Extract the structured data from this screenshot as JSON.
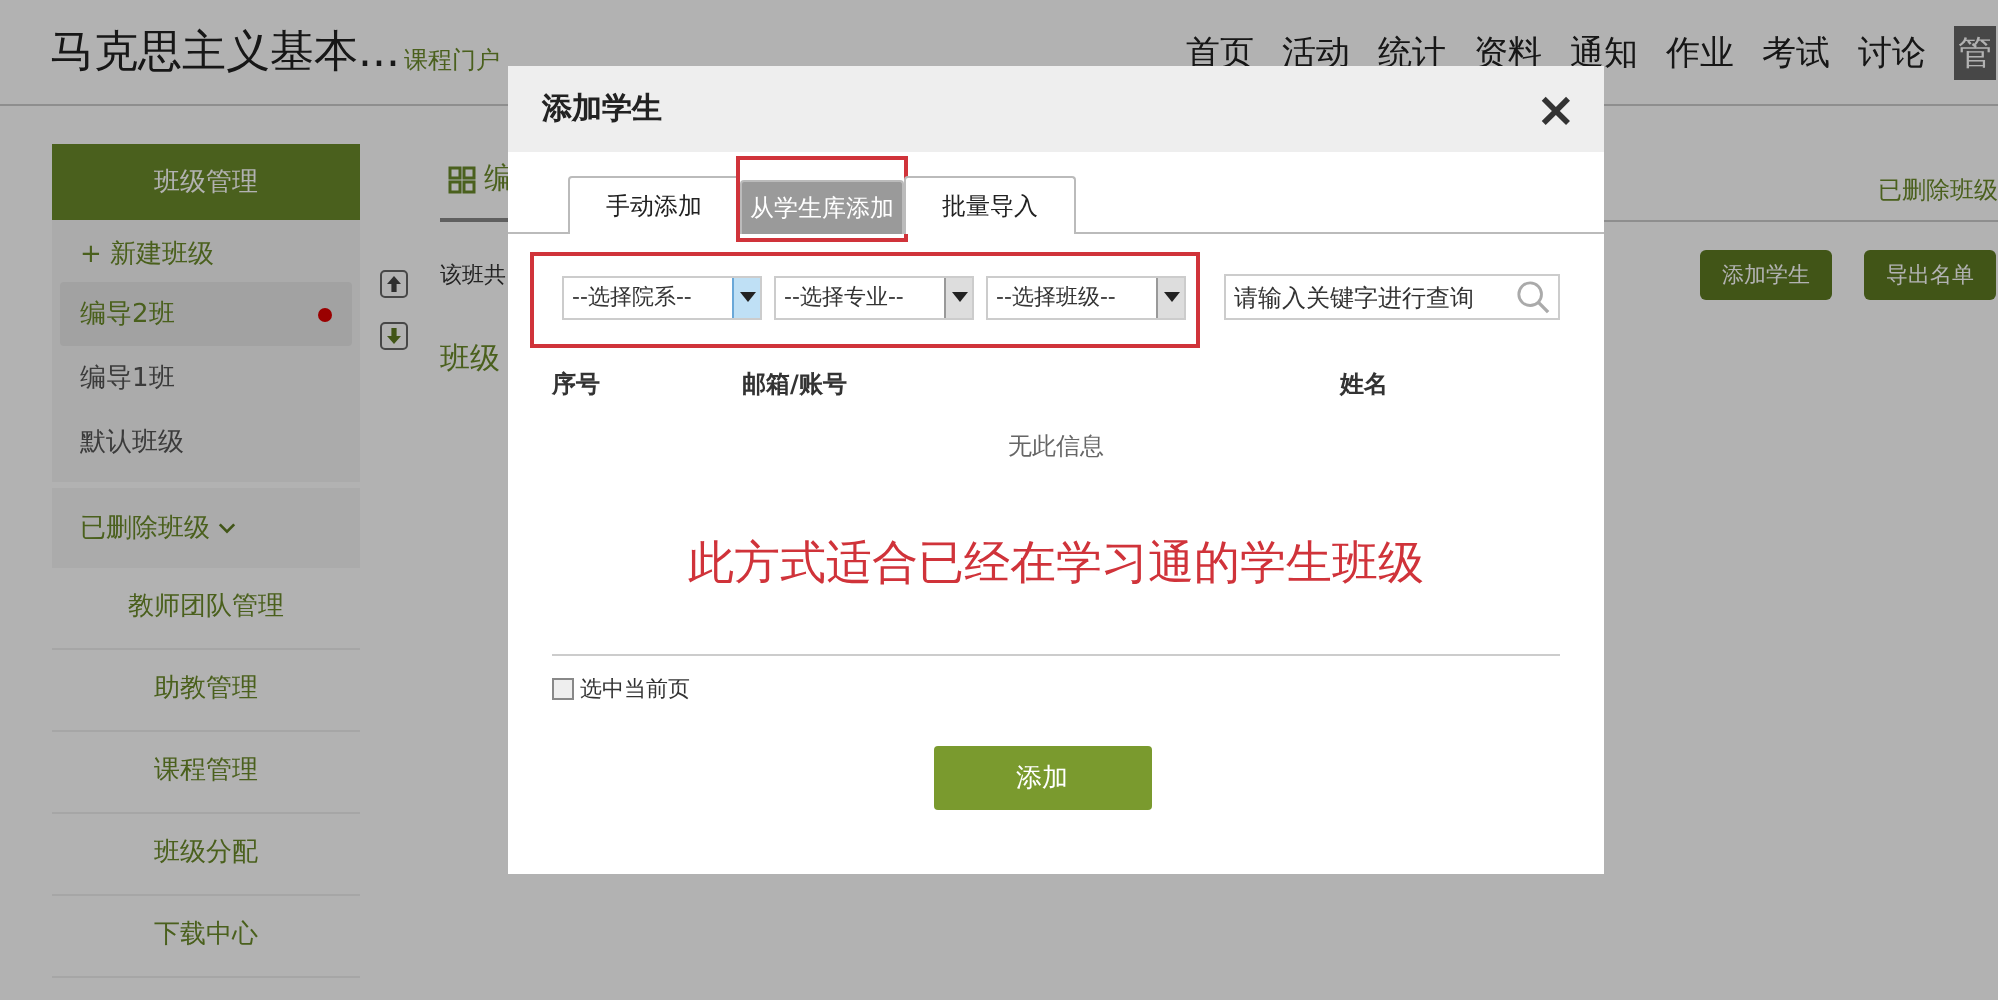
{
  "header": {
    "course_title": "马克思主义基本...",
    "portal_link": "课程门户",
    "nav": [
      {
        "label": "首页",
        "selected": false
      },
      {
        "label": "活动",
        "selected": false
      },
      {
        "label": "统计",
        "selected": false
      },
      {
        "label": "资料",
        "selected": false
      },
      {
        "label": "通知",
        "selected": false
      },
      {
        "label": "作业",
        "selected": false
      },
      {
        "label": "考试",
        "selected": false
      },
      {
        "label": "讨论",
        "selected": false
      },
      {
        "label": "管",
        "selected": true
      }
    ]
  },
  "sidebar": {
    "title": "班级管理",
    "new_class": "+ 新建班级",
    "classes": [
      {
        "label": "编导2班",
        "selected": true,
        "unread": true
      },
      {
        "label": "编导1班",
        "selected": false,
        "unread": false
      },
      {
        "label": "默认班级",
        "selected": false,
        "unread": false
      }
    ],
    "deleted_classes": "已删除班级",
    "menu": [
      "教师团队管理",
      "助教管理",
      "课程管理",
      "班级分配",
      "下载中心"
    ]
  },
  "main": {
    "heading": "编",
    "deleted_link": "已删除班级",
    "summary": "该班共",
    "section_title": "班级",
    "buttons": [
      "添加学生",
      "导出名单"
    ]
  },
  "dialog": {
    "title": "添加学生",
    "close": "×",
    "tabs": [
      {
        "label": "手动添加",
        "selected": false,
        "annotated": false
      },
      {
        "label": "从学生库添加",
        "selected": true,
        "annotated": true
      },
      {
        "label": "批量导入",
        "selected": false,
        "annotated": false
      }
    ],
    "filters_annotated": true,
    "filters": [
      {
        "value": "--选择院系--",
        "focused": true
      },
      {
        "value": "--选择专业--",
        "focused": false
      },
      {
        "value": "--选择班级--",
        "focused": false
      }
    ],
    "search": {
      "placeholder": "请输入关键字进行查询"
    },
    "columns": [
      "序号",
      "邮箱/账号",
      "姓名"
    ],
    "empty_text": "无此信息",
    "note": "此方式适合已经在学习通的学生班级",
    "select_page": {
      "label": "选中当前页",
      "checked": false
    },
    "submit": "添加"
  }
}
